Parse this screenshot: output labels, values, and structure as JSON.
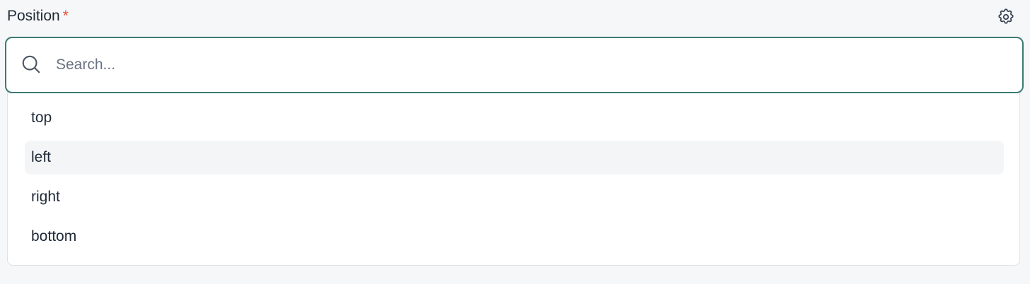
{
  "field": {
    "label": "Position",
    "required_mark": "*",
    "settings_icon": "gear-icon"
  },
  "search": {
    "icon": "search-icon",
    "placeholder": "Search...",
    "value": ""
  },
  "options": [
    {
      "label": "top",
      "highlighted": false
    },
    {
      "label": "left",
      "highlighted": true
    },
    {
      "label": "right",
      "highlighted": false
    },
    {
      "label": "bottom",
      "highlighted": false
    }
  ],
  "colors": {
    "focus_border": "#3b7a73",
    "required": "#e5533d",
    "highlight_bg": "#f4f5f7",
    "page_bg": "#f6f7f9"
  }
}
